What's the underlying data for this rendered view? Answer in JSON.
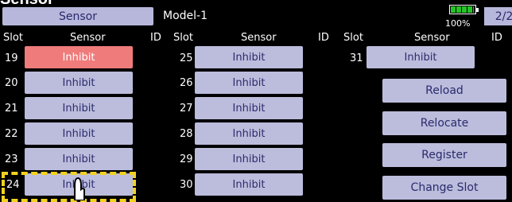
{
  "screen": {
    "title": "Sensor",
    "tab_label": "Sensor",
    "model": "Model-1",
    "battery_percent": "100%",
    "battery_level": 1.0,
    "page": "2/2"
  },
  "columns": {
    "slot": "Slot",
    "sensor": "Sensor",
    "id": "ID"
  },
  "slots": [
    {
      "slot": "19",
      "sensor": "Inhibit",
      "selected": true
    },
    {
      "slot": "20",
      "sensor": "Inhibit"
    },
    {
      "slot": "21",
      "sensor": "Inhibit"
    },
    {
      "slot": "22",
      "sensor": "Inhibit"
    },
    {
      "slot": "23",
      "sensor": "Inhibit"
    },
    {
      "slot": "24",
      "sensor": "Inhibit",
      "focused": true
    },
    {
      "slot": "25",
      "sensor": "Inhibit"
    },
    {
      "slot": "26",
      "sensor": "Inhibit"
    },
    {
      "slot": "27",
      "sensor": "Inhibit"
    },
    {
      "slot": "28",
      "sensor": "Inhibit"
    },
    {
      "slot": "29",
      "sensor": "Inhibit"
    },
    {
      "slot": "30",
      "sensor": "Inhibit"
    },
    {
      "slot": "31",
      "sensor": "Inhibit"
    }
  ],
  "actions": {
    "reload": "Reload",
    "relocate": "Relocate",
    "register": "Register",
    "change_slot": "Change Slot"
  },
  "colors": {
    "button": "#bcbcdd",
    "button_text": "#2b2b6b",
    "selected": "#ef7b7b",
    "focus": "#f2d21e",
    "battery": "#27c427"
  }
}
